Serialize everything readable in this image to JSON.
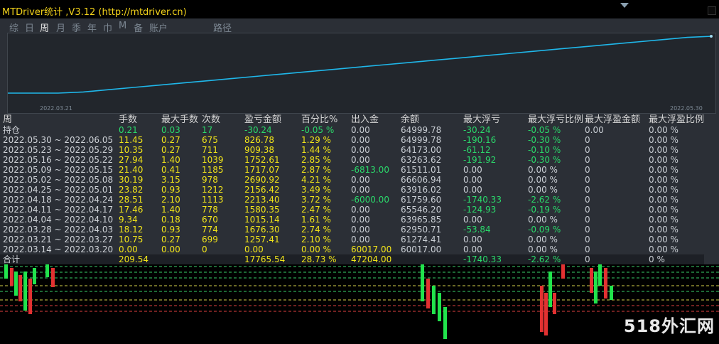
{
  "title": "MTDriver统计  ,V3.12 (http://mtdriver.cn)",
  "tabs": [
    "综",
    "日",
    "周",
    "月",
    "季",
    "年",
    "巾",
    "M",
    "备",
    "账户"
  ],
  "path_tab": "路径",
  "chart": {
    "start_label": "2022.03.21",
    "end_label": "2022.05.30",
    "line_color": "#1fb7ea",
    "values": [
      0,
      0,
      0,
      0.02,
      0.06,
      0.1,
      0.14,
      0.18,
      0.22,
      0.26,
      0.3,
      0.34,
      0.38,
      0.42,
      0.46,
      0.5,
      0.54,
      0.58,
      0.62,
      0.66,
      0.7,
      0.74,
      0.78,
      0.82,
      0.86,
      0.9,
      0.94,
      0.98,
      1
    ]
  },
  "table": {
    "period_label": "周",
    "columns": [
      "手数",
      "最大手数",
      "次数",
      "盈亏金额",
      "百分比%",
      "出入金",
      "余额",
      "最大浮亏",
      "最大浮亏比例",
      "最大浮盈金额",
      "最大浮盈比例"
    ],
    "holding": {
      "label": "持仓",
      "cells": [
        "0.21",
        "0.03",
        "17",
        "-30.24",
        "-0.05 %",
        "0.00",
        "64999.78",
        "-30.24",
        "-0.05 %",
        "0.00",
        "0.00 %"
      ]
    },
    "rows": [
      {
        "label": "2022.05.30 ~ 2022.06.05",
        "cells": [
          "11.45",
          "0.27",
          "675",
          "826.78",
          "1.29 %",
          "0.00",
          "64999.78",
          "-190.16",
          "-0.30 %",
          "0",
          "0.00 %"
        ]
      },
      {
        "label": "2022.05.23 ~ 2022.05.29",
        "cells": [
          "10.35",
          "0.27",
          "711",
          "909.38",
          "1.44 %",
          "0.00",
          "64173.00",
          "-61.12",
          "-0.10 %",
          "0",
          "0.00 %"
        ]
      },
      {
        "label": "2022.05.16 ~ 2022.05.22",
        "cells": [
          "27.94",
          "1.40",
          "1039",
          "1752.61",
          "2.85 %",
          "0.00",
          "63263.62",
          "-191.92",
          "-0.30 %",
          "0",
          "0.00 %"
        ]
      },
      {
        "label": "2022.05.09 ~ 2022.05.15",
        "cells": [
          "21.40",
          "0.41",
          "1185",
          "1717.07",
          "2.87 %",
          "-6813.00",
          "61511.01",
          "0.00",
          "0.00 %",
          "0",
          "0.00 %"
        ]
      },
      {
        "label": "2022.05.02 ~ 2022.05.08",
        "cells": [
          "30.19",
          "3.15",
          "978",
          "2690.92",
          "4.21 %",
          "0.00",
          "66606.94",
          "0.00",
          "0.00 %",
          "0",
          "0.00 %"
        ]
      },
      {
        "label": "2022.04.25 ~ 2022.05.01",
        "cells": [
          "23.82",
          "0.93",
          "1212",
          "2156.42",
          "3.49 %",
          "0.00",
          "63916.02",
          "0.00",
          "0.00 %",
          "0",
          "0.00 %"
        ]
      },
      {
        "label": "2022.04.18 ~ 2022.04.24",
        "cells": [
          "28.51",
          "2.10",
          "1113",
          "2213.40",
          "3.72 %",
          "-6000.00",
          "61759.60",
          "-1740.33",
          "-2.62 %",
          "0",
          "0.00 %"
        ]
      },
      {
        "label": "2022.04.11 ~ 2022.04.17",
        "cells": [
          "17.46",
          "1.40",
          "778",
          "1580.35",
          "2.47 %",
          "0.00",
          "65546.20",
          "-124.93",
          "-0.19 %",
          "0",
          "0.00 %"
        ]
      },
      {
        "label": "2022.04.04 ~ 2022.04.10",
        "cells": [
          "9.34",
          "0.18",
          "670",
          "1015.14",
          "1.61 %",
          "0.00",
          "63965.85",
          "0.00",
          "0.00 %",
          "0",
          "0.00 %"
        ]
      },
      {
        "label": "2022.03.28 ~ 2022.04.03",
        "cells": [
          "18.12",
          "0.93",
          "774",
          "1676.30",
          "2.74 %",
          "0.00",
          "62950.71",
          "-53.84",
          "-0.09 %",
          "0",
          "0.00 %"
        ]
      },
      {
        "label": "2022.03.21 ~ 2022.03.27",
        "cells": [
          "10.75",
          "0.27",
          "699",
          "1257.41",
          "2.10 %",
          "0.00",
          "61274.41",
          "0.00",
          "0.00 %",
          "0",
          "0.00 %"
        ]
      },
      {
        "label": "2022.03.14 ~ 2022.03.20",
        "cells": [
          "0.00",
          "0.00",
          "0",
          "0.00",
          "0.00 %",
          "60017.00",
          "60017.00",
          "0.00",
          "0.00 %",
          "0",
          "0.00 %"
        ]
      }
    ],
    "total": {
      "label": "合计",
      "cells": [
        "209.54",
        "",
        "",
        "17765.54",
        "28.73 %",
        "47204.00",
        "",
        "-1740.33",
        "-2.62 %",
        "0",
        "0 %"
      ]
    }
  },
  "watermark": "518外汇网"
}
